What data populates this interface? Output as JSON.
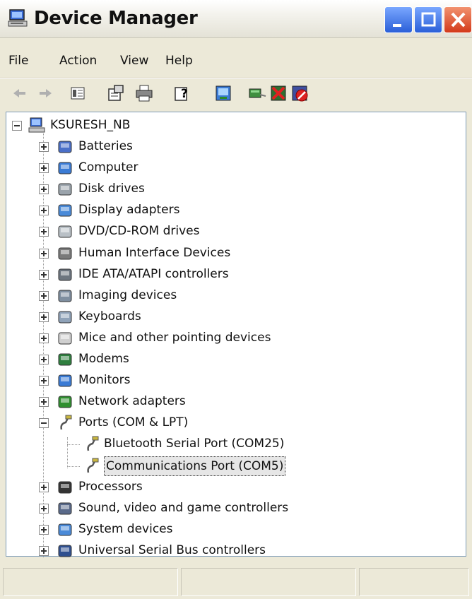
{
  "window": {
    "title": "Device Manager"
  },
  "menu": {
    "file": "File",
    "action": "Action",
    "view": "View",
    "help": "Help"
  },
  "toolbar": {
    "buttons": [
      "back-icon",
      "forward-icon",
      "show-hide-tree-icon",
      "properties-icon",
      "print-icon",
      "help-icon",
      "scan-hardware-icon",
      "update-driver-icon",
      "uninstall-icon",
      "disable-icon"
    ]
  },
  "tree": {
    "root": "KSURESH_NB",
    "categories": [
      "Batteries",
      "Computer",
      "Disk drives",
      "Display adapters",
      "DVD/CD-ROM drives",
      "Human Interface Devices",
      "IDE ATA/ATAPI controllers",
      "Imaging devices",
      "Keyboards",
      "Mice and other pointing devices",
      "Modems",
      "Monitors",
      "Network adapters",
      "Ports (COM & LPT)",
      "Processors",
      "Sound, video and game controllers",
      "System devices",
      "Universal Serial Bus controllers"
    ],
    "ports_children": [
      "Bluetooth Serial Port (COM25)",
      "Communications Port (COM5)"
    ],
    "selected": "Communications Port (COM5)"
  }
}
